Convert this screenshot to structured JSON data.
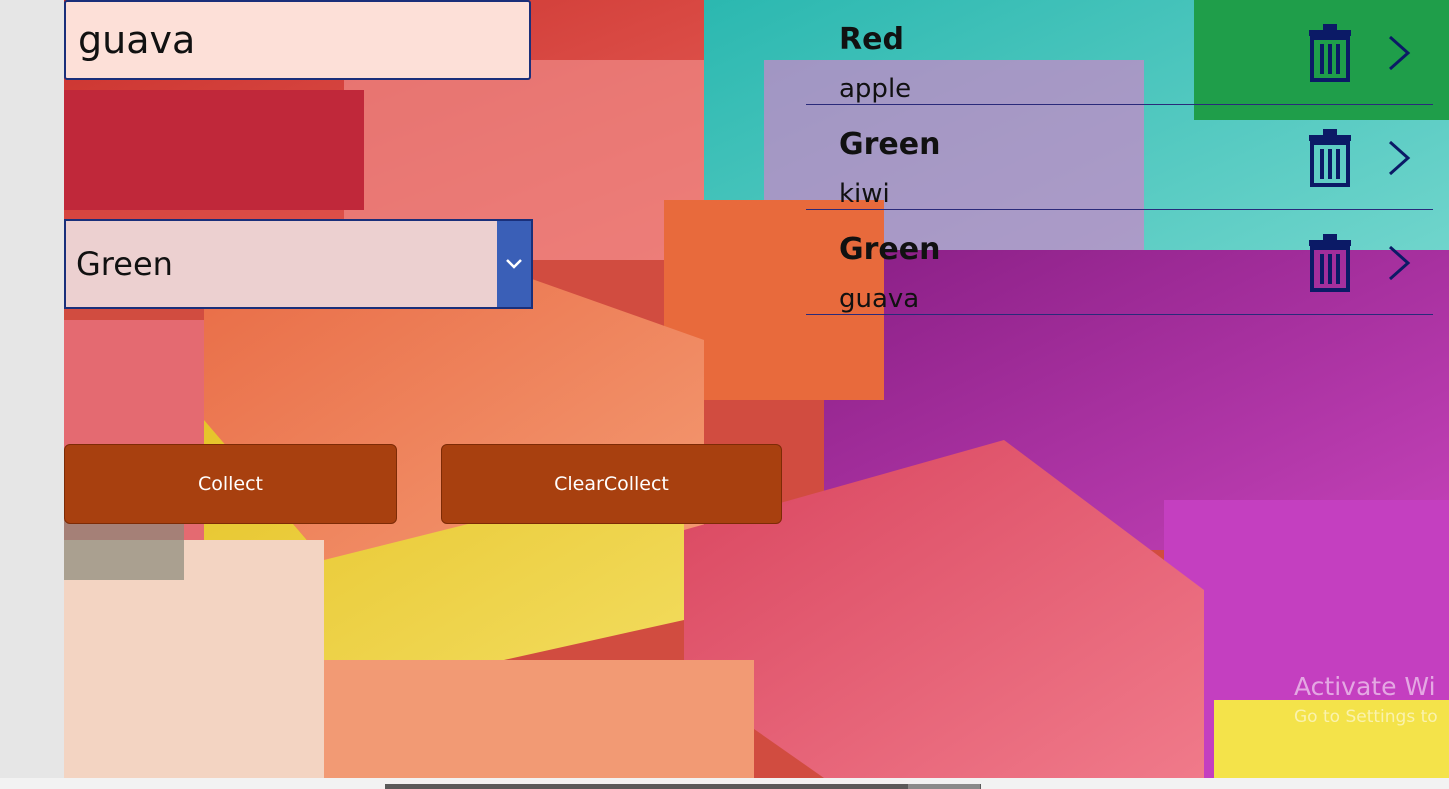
{
  "text_input": {
    "value": "guava"
  },
  "dropdown": {
    "selected": "Green"
  },
  "buttons": {
    "collect": "Collect",
    "clear_collect": "ClearCollect"
  },
  "gallery": {
    "items": [
      {
        "title": "Red",
        "subtitle": "apple"
      },
      {
        "title": "Green",
        "subtitle": "kiwi"
      },
      {
        "title": "Green",
        "subtitle": "guava"
      }
    ]
  },
  "watermark": {
    "line1": "Activate Wi",
    "line2": "Go to Settings to"
  },
  "colors": {
    "button": "#a8400f",
    "input_bg": "#fde0d8",
    "dropdown_bg": "#ecd0d0",
    "chevron_bg": "#3a5fb7",
    "icon": "#0b1a66",
    "border": "#1a2f7a"
  }
}
